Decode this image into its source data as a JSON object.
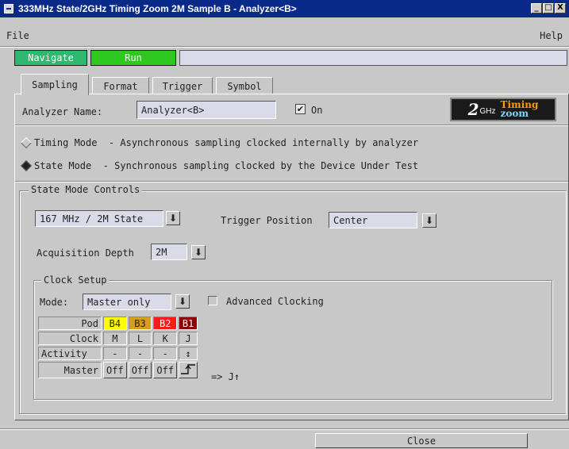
{
  "window": {
    "title": "333MHz State/2GHz Timing Zoom 2M Sample B - Analyzer<B>",
    "minimize": "_",
    "maximize": "□",
    "close": "X"
  },
  "menu": {
    "file": "File",
    "help": "Help"
  },
  "nav": {
    "navigate": "Navigate",
    "run": "Run",
    "status": ""
  },
  "tabs": [
    {
      "label": "Sampling",
      "active": true
    },
    {
      "label": "Format",
      "active": false
    },
    {
      "label": "Trigger",
      "active": false
    },
    {
      "label": "Symbol",
      "active": false
    }
  ],
  "analyzer": {
    "name_label": "Analyzer Name:",
    "name_value": "Analyzer<B>",
    "on_label": "On",
    "on_checked": true
  },
  "logo": {
    "prefix": "2",
    "ghz": "GHz",
    "timing": "Timing",
    "zoom": "zoom"
  },
  "modes": {
    "timing": {
      "label": "Timing Mode  - Asynchronous sampling clocked internally by analyzer",
      "selected": false
    },
    "state": {
      "label": "State Mode  - Synchronous sampling clocked by the Device Under Test",
      "selected": true
    }
  },
  "state_controls": {
    "group_label": "State Mode Controls",
    "speed_value": "167 MHz / 2M State",
    "trigger_position_label": "Trigger Position",
    "trigger_position_value": "Center",
    "acq_depth_label": "Acquisition Depth",
    "acq_depth_value": "2M"
  },
  "clock_setup": {
    "group_label": "Clock Setup",
    "mode_label": "Mode:",
    "mode_value": "Master only",
    "advanced_label": "Advanced Clocking",
    "advanced_checked": false,
    "rows": {
      "pod": "Pod",
      "clock": "Clock",
      "activity": "Activity",
      "master": "Master"
    },
    "pods": [
      {
        "name": "B4",
        "color": "#ffff00",
        "text_color": "#000000",
        "clock": "M",
        "activity": "-",
        "master": "Off"
      },
      {
        "name": "B3",
        "color": "#d4a017",
        "text_color": "#000000",
        "clock": "L",
        "activity": "-",
        "master": "Off"
      },
      {
        "name": "B2",
        "color": "#ff1a1a",
        "text_color": "#ffffff",
        "clock": "K",
        "activity": "-",
        "master": "Off"
      },
      {
        "name": "B1",
        "color": "#8b0000",
        "text_color": "#ffffff",
        "clock": "J",
        "activity": "↕",
        "master": "rising-edge-icon"
      }
    ],
    "equation": "=> J↑"
  },
  "footer": {
    "close": "Close"
  },
  "colors": {
    "title_bg": "#0a2a8a",
    "navigate_bg": "#2fb86f",
    "run_bg": "#2fc81e",
    "field_bg": "#dadbe9",
    "window_bg": "#c8c8c8"
  }
}
